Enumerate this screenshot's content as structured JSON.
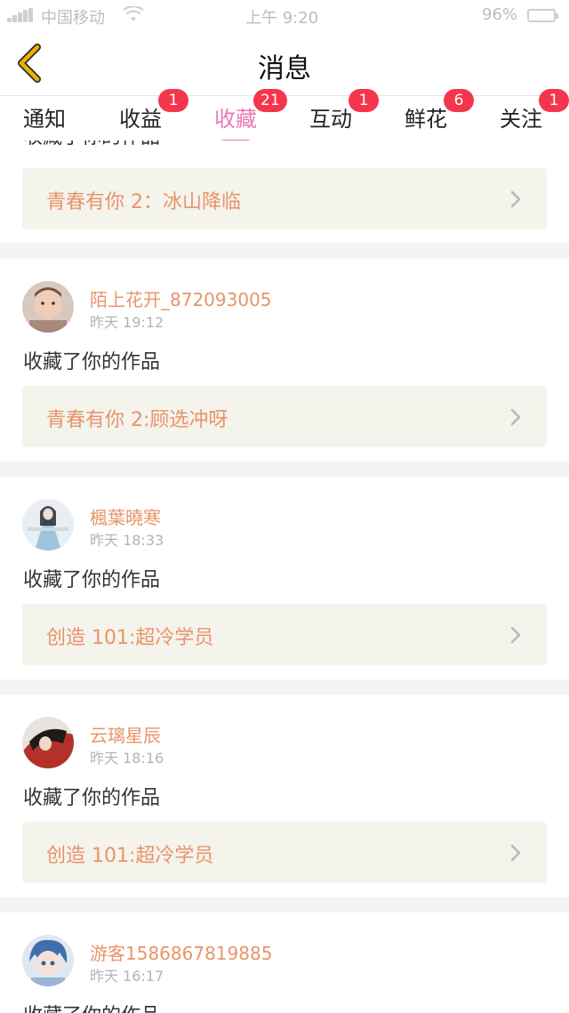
{
  "status_bar": {
    "carrier": "中国移动",
    "time": "上午 9:20",
    "battery": "96%"
  },
  "nav": {
    "title": "消息"
  },
  "tabs": [
    {
      "label": "通知",
      "badge": ""
    },
    {
      "label": "收益",
      "badge": "1"
    },
    {
      "label": "收藏",
      "badge": "21",
      "active": true
    },
    {
      "label": "互动",
      "badge": "1"
    },
    {
      "label": "鲜花",
      "badge": "6"
    },
    {
      "label": "关注",
      "badge": "1"
    }
  ],
  "notifications": [
    {
      "action": "收藏了你的作品",
      "work": "青春有你 2：冰山降临"
    },
    {
      "user": "陌上花开_872093005",
      "time": "昨天 19:12",
      "action": "收藏了你的作品",
      "work": "青春有你 2:顾选冲呀"
    },
    {
      "user": "楓葉曉寒",
      "time": "昨天 18:33",
      "action": "收藏了你的作品",
      "work": "创造 101:超冷学员"
    },
    {
      "user": "云璃星辰",
      "time": "昨天 18:16",
      "action": "收藏了你的作品",
      "work": "创造 101:超冷学员"
    },
    {
      "user": "游客1586867819885",
      "time": "昨天 16:17",
      "action": "收藏了你的作品"
    }
  ],
  "colors": {
    "accent": "#e879b5",
    "username": "#e8946a",
    "badge": "#f4364c",
    "work_bg": "#f4f3ec",
    "back_arrow": "#e6b400"
  }
}
